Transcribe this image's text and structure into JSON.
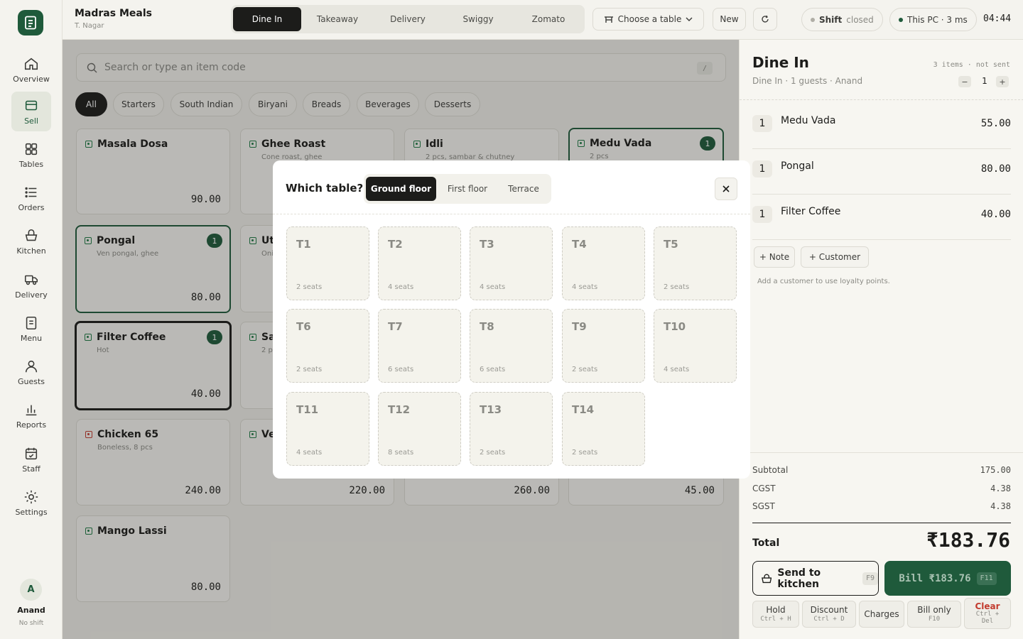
{
  "sidebar": {
    "items": [
      {
        "label": "Overview",
        "icon": "home-icon"
      },
      {
        "label": "Sell",
        "icon": "register-icon"
      },
      {
        "label": "Tables",
        "icon": "grid-icon"
      },
      {
        "label": "Orders",
        "icon": "list-icon"
      },
      {
        "label": "Kitchen",
        "icon": "basket-icon"
      },
      {
        "label": "Delivery",
        "icon": "truck-icon"
      },
      {
        "label": "Menu",
        "icon": "document-icon"
      },
      {
        "label": "Guests",
        "icon": "person-icon"
      },
      {
        "label": "Reports",
        "icon": "bar-chart-icon"
      },
      {
        "label": "Staff",
        "icon": "calendar-check-icon"
      },
      {
        "label": "Settings",
        "icon": "gear-icon"
      }
    ],
    "user": {
      "initial": "A",
      "name": "Anand",
      "shift": "No shift"
    }
  },
  "topbar": {
    "store_name": "Madras Meals",
    "store_location": "T. Nagar",
    "order_types": [
      "Dine In",
      "Takeaway",
      "Delivery",
      "Swiggy",
      "Zomato"
    ],
    "table_button": "Choose a table",
    "new_button": "New",
    "shift_label": "Shift",
    "shift_status": "closed",
    "device_status": "This PC · 3 ms",
    "clock": "04:44"
  },
  "search": {
    "placeholder": "Search or type an item code",
    "shortcut": "/"
  },
  "categories": [
    "All",
    "Starters",
    "South Indian",
    "Biryani",
    "Breads",
    "Beverages",
    "Desserts"
  ],
  "menu_items": [
    {
      "name": "Masala Dosa",
      "desc": "",
      "price": "90.00"
    },
    {
      "name": "Ghee Roast",
      "desc": "Cone roast, ghee",
      "price": ""
    },
    {
      "name": "Idli",
      "desc": "2 pcs, sambar & chutney",
      "price": ""
    },
    {
      "name": "Medu Vada",
      "desc": "2 pcs",
      "price": "",
      "qty": "1"
    },
    {
      "name": "Pongal",
      "desc": "Ven pongal, ghee",
      "price": "80.00",
      "qty": "1"
    },
    {
      "name": "Ut",
      "desc": "Oni",
      "price": ""
    },
    {
      "name": "Filter Coffee",
      "desc": "Hot",
      "price": "40.00",
      "qty": "1"
    },
    {
      "name": "Sa",
      "desc": "2 p",
      "price": ""
    },
    {
      "name": "Chicken 65",
      "desc": "Boneless, 8 pcs",
      "price": "240.00"
    },
    {
      "name": "Ve",
      "desc": "",
      "price": "220.00"
    },
    {
      "name": "",
      "desc": "",
      "price": "260.00"
    },
    {
      "name": "",
      "desc": "",
      "price": "45.00"
    },
    {
      "name": "Mango Lassi",
      "desc": "",
      "price": "80.00"
    }
  ],
  "order": {
    "title": "Dine In",
    "subtitle": "Dine In · 1 guests · Anand",
    "meta": "3 items · not sent",
    "guests": "1",
    "minus": "−",
    "plus": "+",
    "lines": [
      {
        "qty": "1",
        "name": "Medu Vada",
        "price": "55.00"
      },
      {
        "qty": "1",
        "name": "Pongal",
        "price": "80.00"
      },
      {
        "qty": "1",
        "name": "Filter Coffee",
        "price": "40.00"
      }
    ],
    "note_button": "+ Note",
    "customer_button": "+ Customer",
    "loyalty_hint": "Add a customer to use loyalty points.",
    "subtotal_label": "Subtotal",
    "subtotal": "175.00",
    "cgst_label": "CGST",
    "cgst": "4.38",
    "sgst_label": "SGST",
    "sgst": "4.38",
    "total_label": "Total",
    "total": "₹183.76",
    "send_label": "Send to kitchen",
    "send_key": "F9",
    "bill_label": "Bill ₹183.76",
    "bill_key": "F11",
    "hold_label": "Hold",
    "hold_key": "Ctrl + H",
    "discount_label": "Discount",
    "discount_key": "Ctrl + D",
    "charges_label": "Charges",
    "billonly_label": "Bill only",
    "billonly_key": "F10",
    "clear_label": "Clear",
    "clear_key": "Ctrl + Del"
  },
  "modal": {
    "title": "Which table?",
    "floors": [
      "Ground floor",
      "First floor",
      "Terrace"
    ],
    "tables": [
      {
        "name": "T1",
        "seats": "2 seats"
      },
      {
        "name": "T2",
        "seats": "4 seats"
      },
      {
        "name": "T3",
        "seats": "4 seats"
      },
      {
        "name": "T4",
        "seats": "4 seats"
      },
      {
        "name": "T5",
        "seats": "2 seats"
      },
      {
        "name": "T6",
        "seats": "2 seats"
      },
      {
        "name": "T7",
        "seats": "6 seats"
      },
      {
        "name": "T8",
        "seats": "6 seats"
      },
      {
        "name": "T9",
        "seats": "2 seats"
      },
      {
        "name": "T10",
        "seats": "4 seats"
      },
      {
        "name": "T11",
        "seats": "4 seats"
      },
      {
        "name": "T12",
        "seats": "8 seats"
      },
      {
        "name": "T13",
        "seats": "2 seats"
      },
      {
        "name": "T14",
        "seats": "2 seats"
      }
    ]
  },
  "colors": {
    "brand": "#1f5a3b",
    "dark": "#1c1c1a",
    "danger": "#c23b2e",
    "veg": "#1f7a45"
  }
}
